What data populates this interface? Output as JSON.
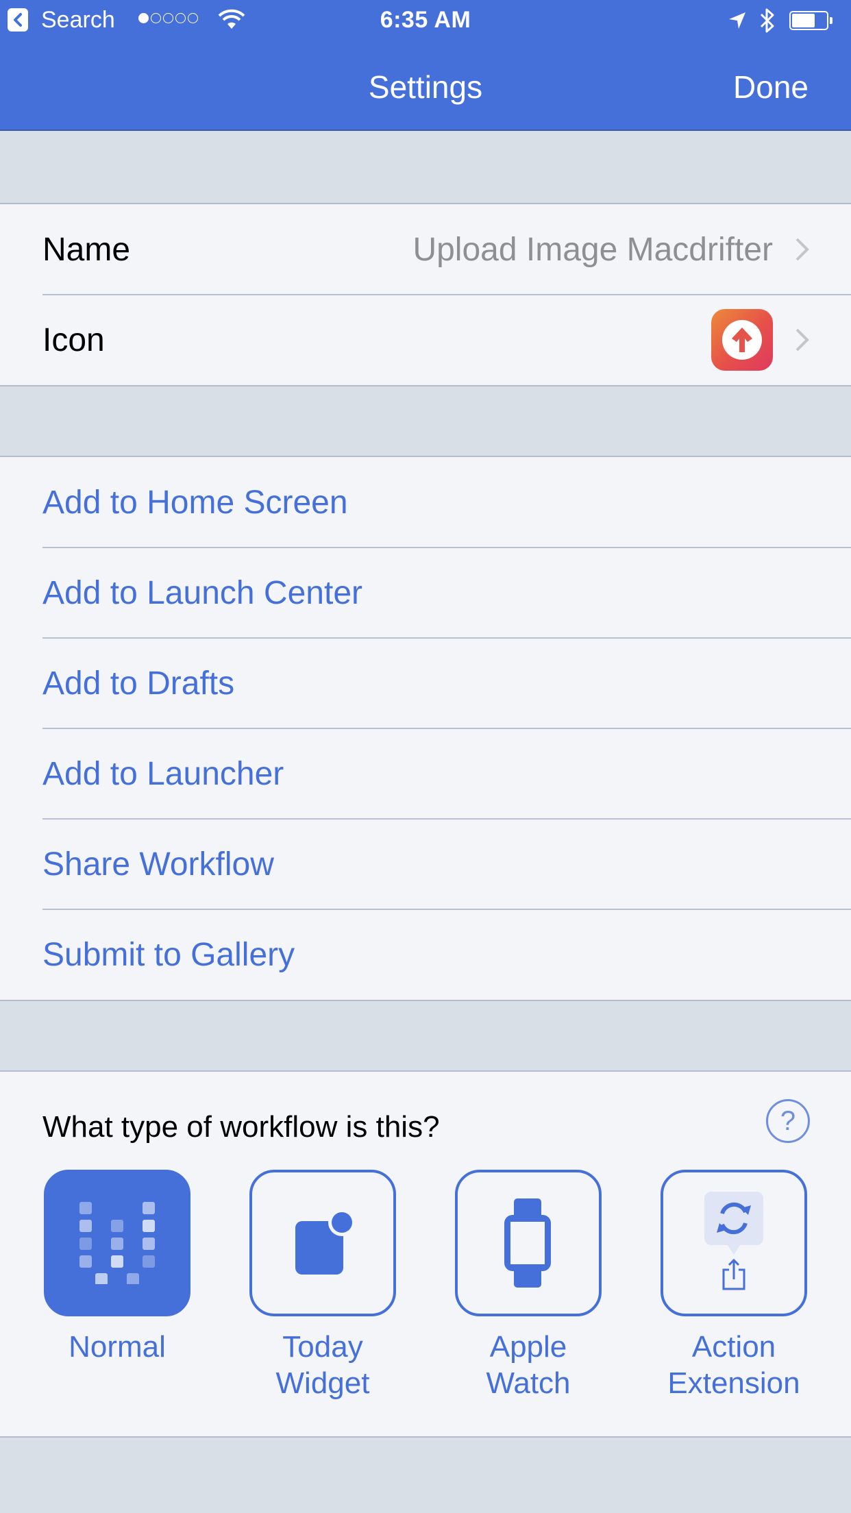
{
  "status_bar": {
    "back_app": "Search",
    "signal_bars_filled": 1,
    "signal_bars_total": 5,
    "time": "6:35 AM",
    "battery_fraction": 0.7,
    "icons": [
      "back-app-icon",
      "signal-dots-icon",
      "wifi-icon",
      "location-icon",
      "bluetooth-icon",
      "battery-icon"
    ]
  },
  "nav": {
    "title": "Settings",
    "done_label": "Done"
  },
  "info_group": {
    "name_label": "Name",
    "name_value": "Upload Image Macdrifter",
    "icon_label": "Icon",
    "icon_glyph": "upload-arrow-icon"
  },
  "actions": [
    {
      "label": "Add to Home Screen"
    },
    {
      "label": "Add to Launch Center"
    },
    {
      "label": "Add to Drafts"
    },
    {
      "label": "Add to Launcher"
    },
    {
      "label": "Share Workflow"
    },
    {
      "label": "Submit to Gallery"
    }
  ],
  "workflow_type": {
    "question": "What type of workflow is this?",
    "help_label": "?",
    "selected": "Normal",
    "options": [
      {
        "label": "Normal",
        "icon": "workflow-logo-icon"
      },
      {
        "label": "Today\nWidget",
        "icon": "today-widget-icon"
      },
      {
        "label": "Apple\nWatch",
        "icon": "apple-watch-icon"
      },
      {
        "label": "Action\nExtension",
        "icon": "action-extension-icon"
      }
    ]
  },
  "colors": {
    "accent": "#4670d9",
    "background": "#d8dfe7",
    "cell": "#f3f5f9",
    "secondary_text": "#8e8e93"
  }
}
